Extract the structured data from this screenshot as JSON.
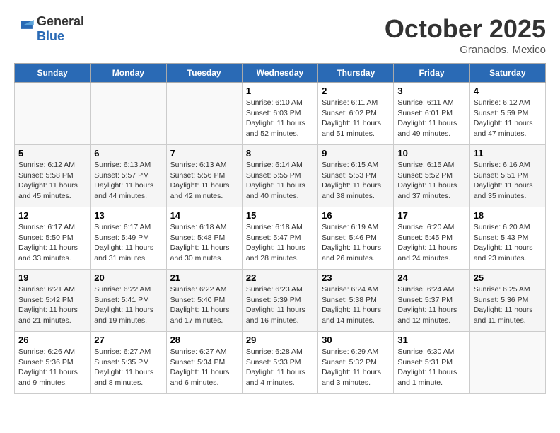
{
  "logo": {
    "line1": "General",
    "line2": "Blue"
  },
  "title": "October 2025",
  "subtitle": "Granados, Mexico",
  "days_of_week": [
    "Sunday",
    "Monday",
    "Tuesday",
    "Wednesday",
    "Thursday",
    "Friday",
    "Saturday"
  ],
  "weeks": [
    [
      {
        "day": "",
        "info": ""
      },
      {
        "day": "",
        "info": ""
      },
      {
        "day": "",
        "info": ""
      },
      {
        "day": "1",
        "info": "Sunrise: 6:10 AM\nSunset: 6:03 PM\nDaylight: 11 hours\nand 52 minutes."
      },
      {
        "day": "2",
        "info": "Sunrise: 6:11 AM\nSunset: 6:02 PM\nDaylight: 11 hours\nand 51 minutes."
      },
      {
        "day": "3",
        "info": "Sunrise: 6:11 AM\nSunset: 6:01 PM\nDaylight: 11 hours\nand 49 minutes."
      },
      {
        "day": "4",
        "info": "Sunrise: 6:12 AM\nSunset: 5:59 PM\nDaylight: 11 hours\nand 47 minutes."
      }
    ],
    [
      {
        "day": "5",
        "info": "Sunrise: 6:12 AM\nSunset: 5:58 PM\nDaylight: 11 hours\nand 45 minutes."
      },
      {
        "day": "6",
        "info": "Sunrise: 6:13 AM\nSunset: 5:57 PM\nDaylight: 11 hours\nand 44 minutes."
      },
      {
        "day": "7",
        "info": "Sunrise: 6:13 AM\nSunset: 5:56 PM\nDaylight: 11 hours\nand 42 minutes."
      },
      {
        "day": "8",
        "info": "Sunrise: 6:14 AM\nSunset: 5:55 PM\nDaylight: 11 hours\nand 40 minutes."
      },
      {
        "day": "9",
        "info": "Sunrise: 6:15 AM\nSunset: 5:53 PM\nDaylight: 11 hours\nand 38 minutes."
      },
      {
        "day": "10",
        "info": "Sunrise: 6:15 AM\nSunset: 5:52 PM\nDaylight: 11 hours\nand 37 minutes."
      },
      {
        "day": "11",
        "info": "Sunrise: 6:16 AM\nSunset: 5:51 PM\nDaylight: 11 hours\nand 35 minutes."
      }
    ],
    [
      {
        "day": "12",
        "info": "Sunrise: 6:17 AM\nSunset: 5:50 PM\nDaylight: 11 hours\nand 33 minutes."
      },
      {
        "day": "13",
        "info": "Sunrise: 6:17 AM\nSunset: 5:49 PM\nDaylight: 11 hours\nand 31 minutes."
      },
      {
        "day": "14",
        "info": "Sunrise: 6:18 AM\nSunset: 5:48 PM\nDaylight: 11 hours\nand 30 minutes."
      },
      {
        "day": "15",
        "info": "Sunrise: 6:18 AM\nSunset: 5:47 PM\nDaylight: 11 hours\nand 28 minutes."
      },
      {
        "day": "16",
        "info": "Sunrise: 6:19 AM\nSunset: 5:46 PM\nDaylight: 11 hours\nand 26 minutes."
      },
      {
        "day": "17",
        "info": "Sunrise: 6:20 AM\nSunset: 5:45 PM\nDaylight: 11 hours\nand 24 minutes."
      },
      {
        "day": "18",
        "info": "Sunrise: 6:20 AM\nSunset: 5:43 PM\nDaylight: 11 hours\nand 23 minutes."
      }
    ],
    [
      {
        "day": "19",
        "info": "Sunrise: 6:21 AM\nSunset: 5:42 PM\nDaylight: 11 hours\nand 21 minutes."
      },
      {
        "day": "20",
        "info": "Sunrise: 6:22 AM\nSunset: 5:41 PM\nDaylight: 11 hours\nand 19 minutes."
      },
      {
        "day": "21",
        "info": "Sunrise: 6:22 AM\nSunset: 5:40 PM\nDaylight: 11 hours\nand 17 minutes."
      },
      {
        "day": "22",
        "info": "Sunrise: 6:23 AM\nSunset: 5:39 PM\nDaylight: 11 hours\nand 16 minutes."
      },
      {
        "day": "23",
        "info": "Sunrise: 6:24 AM\nSunset: 5:38 PM\nDaylight: 11 hours\nand 14 minutes."
      },
      {
        "day": "24",
        "info": "Sunrise: 6:24 AM\nSunset: 5:37 PM\nDaylight: 11 hours\nand 12 minutes."
      },
      {
        "day": "25",
        "info": "Sunrise: 6:25 AM\nSunset: 5:36 PM\nDaylight: 11 hours\nand 11 minutes."
      }
    ],
    [
      {
        "day": "26",
        "info": "Sunrise: 6:26 AM\nSunset: 5:36 PM\nDaylight: 11 hours\nand 9 minutes."
      },
      {
        "day": "27",
        "info": "Sunrise: 6:27 AM\nSunset: 5:35 PM\nDaylight: 11 hours\nand 8 minutes."
      },
      {
        "day": "28",
        "info": "Sunrise: 6:27 AM\nSunset: 5:34 PM\nDaylight: 11 hours\nand 6 minutes."
      },
      {
        "day": "29",
        "info": "Sunrise: 6:28 AM\nSunset: 5:33 PM\nDaylight: 11 hours\nand 4 minutes."
      },
      {
        "day": "30",
        "info": "Sunrise: 6:29 AM\nSunset: 5:32 PM\nDaylight: 11 hours\nand 3 minutes."
      },
      {
        "day": "31",
        "info": "Sunrise: 6:30 AM\nSunset: 5:31 PM\nDaylight: 11 hours\nand 1 minute."
      },
      {
        "day": "",
        "info": ""
      }
    ]
  ]
}
